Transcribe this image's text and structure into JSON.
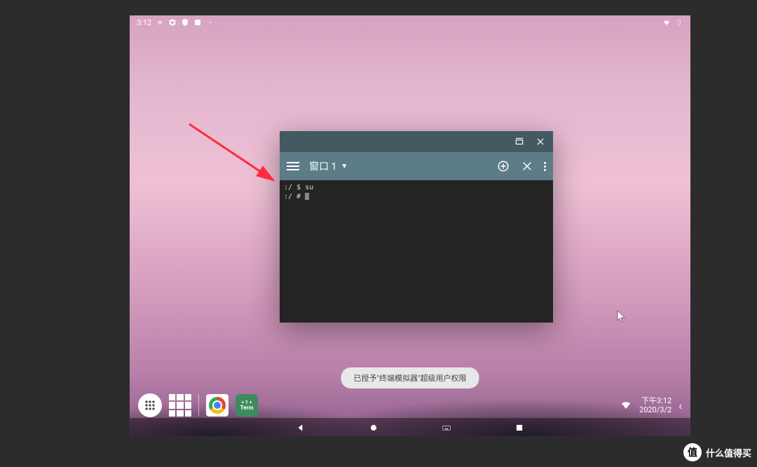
{
  "status_bar": {
    "time": "3:12",
    "icons_left": [
      "wifi-icon",
      "gear-icon",
      "shield-icon",
      "app-badge-icon",
      "dot-icon"
    ],
    "icons_right": [
      "wifi-icon",
      "battery-icon"
    ]
  },
  "terminal": {
    "window_controls": [
      "maximize",
      "close"
    ],
    "tab_label": "窗口 1",
    "toolbar_icons": [
      "add",
      "close",
      "menu"
    ],
    "lines": [
      {
        "prompt": ":/ $ ",
        "cmd": "su"
      },
      {
        "prompt": ":/ # ",
        "cmd": ""
      }
    ]
  },
  "toast": {
    "message": "已授予\"终端模拟器\"超级用户权限"
  },
  "taskbar": {
    "apps": [
      "chrome",
      "term"
    ],
    "term_label_top": "> 1 +",
    "term_label_bottom": "Term",
    "clock_time": "下午3:12",
    "clock_date": "2020/3/2"
  },
  "watermark": {
    "badge": "值",
    "text": "什么值得买"
  }
}
